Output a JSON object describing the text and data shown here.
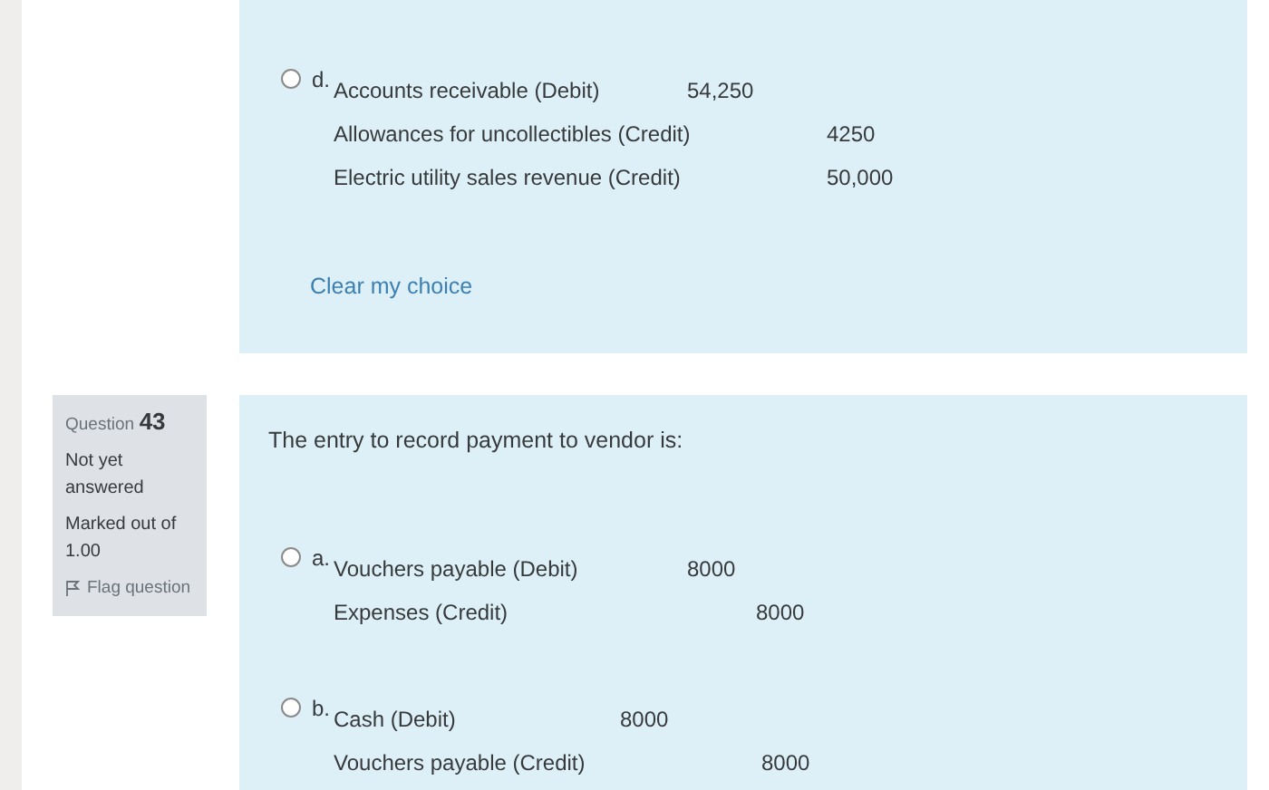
{
  "previous_question": {
    "options": [
      {
        "letter": "d.",
        "selected": false,
        "lines": [
          {
            "account": "Accounts receivable (Debit)",
            "debit": "54,250"
          },
          {
            "account": "Allowances for uncollectibles (Credit)",
            "credit": "4250"
          },
          {
            "account": "Electric utility sales revenue (Credit)",
            "credit": "50,000"
          }
        ]
      }
    ],
    "clear_link": "Clear my choice"
  },
  "question": {
    "info": {
      "label": "Question",
      "number": "43",
      "status": "Not yet answered",
      "marks": "Marked out of 1.00",
      "flag": "Flag question"
    },
    "text": "The entry to record payment to vendor is:",
    "options": [
      {
        "letter": "a.",
        "selected": false,
        "lines": [
          {
            "account": "Vouchers payable (Debit)",
            "debit": "8000"
          },
          {
            "account": "Expenses (Credit)",
            "credit": "8000"
          }
        ]
      },
      {
        "letter": "b.",
        "selected": false,
        "lines": [
          {
            "account": "Cash (Debit)",
            "debit": "8000"
          },
          {
            "account": "Vouchers payable (Credit)",
            "credit": "8000"
          }
        ]
      }
    ]
  }
}
